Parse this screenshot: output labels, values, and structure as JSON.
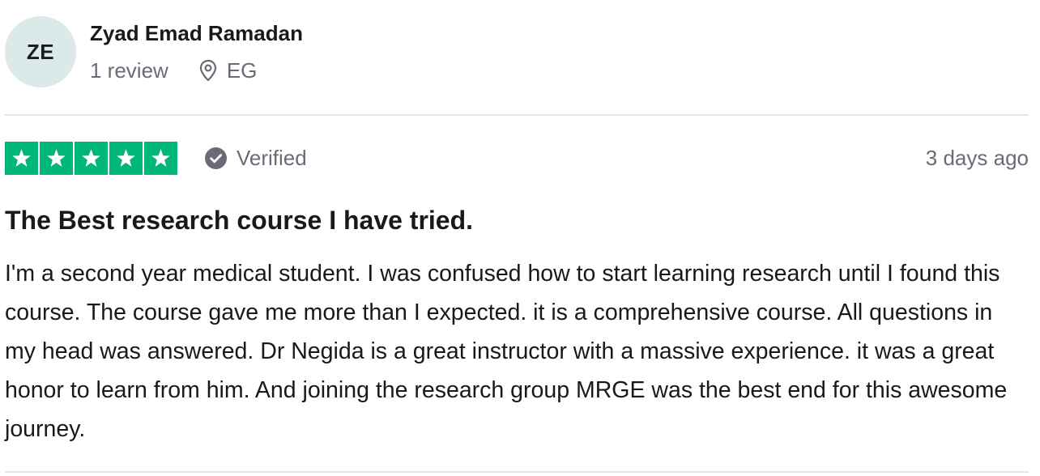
{
  "reviewer": {
    "initials": "ZE",
    "name": "Zyad Emad Ramadan",
    "review_count": "1 review",
    "location": "EG",
    "avatar_color": "#dce9e9"
  },
  "review": {
    "rating": 5,
    "rating_max": 5,
    "star_color": "#00b67a",
    "verified_label": "Verified",
    "date": "3 days ago",
    "title": "The Best research course I have tried.",
    "body": "I'm a second year medical student. I was confused how to start learning research until I found this course. The course gave me more than I expected. it is a comprehensive course. All questions in my head was answered. Dr Negida is a great instructor with a massive experience. it was a great honor to learn from him. And joining the research group MRGE was the best end for this awesome journey."
  },
  "icons": {
    "location": "map-pin-icon",
    "verified": "verified-check-icon",
    "star": "star-icon"
  }
}
